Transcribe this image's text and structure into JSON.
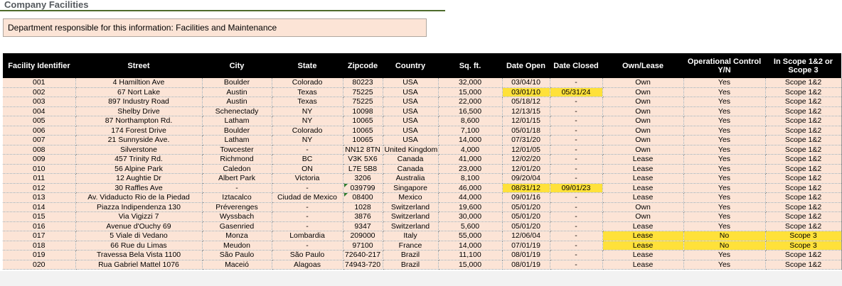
{
  "page": {
    "title": "Company Facilities",
    "department_note": "Department responsible for this information: Facilities and Maintenance"
  },
  "colors": {
    "row_fill": "#fce4d6",
    "header_fill": "#000000",
    "highlight": "#ffe13a",
    "title_rule": "#4e6b2c"
  },
  "table": {
    "headers": [
      "Facility Identifier",
      "Street",
      "City",
      "State",
      "Zipcode",
      "Country",
      "Sq. ft.",
      "Date Open",
      "Date Closed",
      "Own/Lease",
      "Operational Control Y/N",
      "In Scope 1&2 or Scope 3"
    ],
    "rows": [
      [
        "001",
        "4 Hamiltion Ave",
        "Boulder",
        "Colorado",
        "80223",
        "USA",
        "32,000",
        "03/04/10",
        "-",
        "Own",
        "Yes",
        "Scope 1&2"
      ],
      [
        "002",
        "67 Nort Lake",
        "Austin",
        "Texas",
        "75225",
        "USA",
        "15,000",
        "03/01/10",
        "05/31/24",
        "Own",
        "Yes",
        "Scope 1&2"
      ],
      [
        "003",
        "897 Industry Road",
        "Austin",
        "Texas",
        "75225",
        "USA",
        "22,000",
        "05/18/12",
        "-",
        "Own",
        "Yes",
        "Scope 1&2"
      ],
      [
        "004",
        "Shelby Drive",
        "Schenectady",
        "NY",
        "10098",
        "USA",
        "16,500",
        "12/13/15",
        "-",
        "Own",
        "Yes",
        "Scope 1&2"
      ],
      [
        "005",
        "87 Northampton Rd.",
        "Latham",
        "NY",
        "10065",
        "USA",
        "8,600",
        "12/01/15",
        "-",
        "Own",
        "Yes",
        "Scope 1&2"
      ],
      [
        "006",
        "174 Forest Drive",
        "Boulder",
        "Colorado",
        "10065",
        "USA",
        "7,100",
        "05/01/18",
        "-",
        "Own",
        "Yes",
        "Scope 1&2"
      ],
      [
        "007",
        "21 Sunnyside Ave.",
        "Latham",
        "NY",
        "10065",
        "USA",
        "14,000",
        "07/31/20",
        "-",
        "Own",
        "Yes",
        "Scope 1&2"
      ],
      [
        "008",
        "Silverstone",
        "Towcester",
        "-",
        "NN12 8TN",
        "United Kingdom",
        "4,000",
        "12/01/05",
        "-",
        "Own",
        "Yes",
        "Scope 1&2"
      ],
      [
        "009",
        "457 Trinity Rd.",
        "Richmond",
        "BC",
        "V3K 5X6",
        "Canada",
        "41,000",
        "12/02/20",
        "-",
        "Lease",
        "Yes",
        "Scope 1&2"
      ],
      [
        "010",
        "56 Alpine Park",
        "Caledon",
        "ON",
        "L7E 5B8",
        "Canada",
        "23,000",
        "12/01/20",
        "-",
        "Lease",
        "Yes",
        "Scope 1&2"
      ],
      [
        "011",
        "12 Aughtie Dr",
        "Albert Park",
        "Victoria",
        "3206",
        "Australia",
        "8,100",
        "09/20/04",
        "-",
        "Lease",
        "Yes",
        "Scope 1&2"
      ],
      [
        "012",
        "30 Raffles Ave",
        "-",
        "-",
        "039799",
        "Singapore",
        "46,000",
        "08/31/12",
        "09/01/23",
        "Lease",
        "Yes",
        "Scope 1&2"
      ],
      [
        "013",
        "Av. Vidaducto Rio de la Piedad",
        "Iztacalco",
        "Ciudad de Mexico",
        "08400",
        "Mexico",
        "44,000",
        "09/01/16",
        "-",
        "Lease",
        "Yes",
        "Scope 1&2"
      ],
      [
        "014",
        "Piazza Indipendenza 130",
        "Préverenges",
        "-",
        "1028",
        "Switzerland",
        "19,600",
        "05/01/20",
        "-",
        "Own",
        "Yes",
        "Scope 1&2"
      ],
      [
        "015",
        "Via Vigizzi 7",
        "Wyssbach",
        "-",
        "3876",
        "Switzerland",
        "30,000",
        "05/01/20",
        "-",
        "Own",
        "Yes",
        "Scope 1&2"
      ],
      [
        "016",
        "Avenue d'Ouchy 69",
        "Gasenried",
        "-",
        "9347",
        "Switzerland",
        "5,600",
        "05/01/20",
        "-",
        "Lease",
        "Yes",
        "Scope 1&2"
      ],
      [
        "017",
        "5 Viale di Vedano",
        "Monza",
        "Lombardia",
        "209000",
        "Italy",
        "55,000",
        "12/06/04",
        "-",
        "Lease",
        "No",
        "Scope 3"
      ],
      [
        "018",
        "66 Rue du Limas",
        "Meudon",
        "-",
        "97100",
        "France",
        "14,000",
        "07/01/19",
        "-",
        "Lease",
        "No",
        "Scope 3"
      ],
      [
        "019",
        "Travessa Bela Vista 1100",
        "São Paulo",
        "São Paulo",
        "72640-217",
        "Brazil",
        "11,100",
        "08/01/19",
        "-",
        "Lease",
        "Yes",
        "Scope 1&2"
      ],
      [
        "020",
        "Rua Gabriel Mattel 1076",
        "Maceió",
        "Alagoas",
        "74943-720",
        "Brazil",
        "15,000",
        "08/01/19",
        "-",
        "Lease",
        "Yes",
        "Scope 1&2"
      ]
    ],
    "highlighted_cells": [
      [
        1,
        7
      ],
      [
        1,
        8
      ],
      [
        11,
        7
      ],
      [
        11,
        8
      ],
      [
        16,
        9
      ],
      [
        16,
        10
      ],
      [
        16,
        11
      ],
      [
        17,
        9
      ],
      [
        17,
        10
      ],
      [
        17,
        11
      ]
    ],
    "flagged_cells": [
      [
        11,
        4
      ],
      [
        12,
        4
      ]
    ]
  }
}
